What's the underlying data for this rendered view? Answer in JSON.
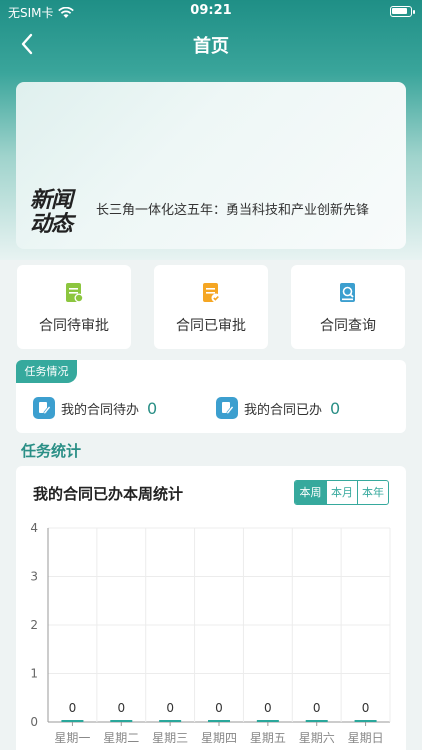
{
  "status_bar": {
    "carrier": "无SIM卡",
    "time": "09:21"
  },
  "nav": {
    "title": "首页"
  },
  "banner": {
    "logo_line1": "新闻",
    "logo_line2": "动态",
    "headline": "长三角一体化这五年：勇当科技和产业创新先锋"
  },
  "quick_actions": [
    {
      "label": "合同待审批",
      "icon": "pending-document-icon"
    },
    {
      "label": "合同已审批",
      "icon": "approved-document-icon"
    },
    {
      "label": "合同查询",
      "icon": "search-document-icon"
    }
  ],
  "tasks": {
    "tag": "任务情况",
    "items": [
      {
        "label": "我的合同待办",
        "count": "0"
      },
      {
        "label": "我的合同已办",
        "count": "0"
      }
    ]
  },
  "section": {
    "title": "任务统计"
  },
  "stats": {
    "title": "我的合同已办本周统计",
    "tabs": [
      "本周",
      "本月",
      "本年"
    ],
    "active_tab": "本周"
  },
  "colors": {
    "accent": "#36a99d",
    "header": "#1f8f86",
    "bar": "#2aa79b"
  },
  "chart_data": {
    "type": "bar",
    "categories": [
      "星期一",
      "星期二",
      "星期三",
      "星期四",
      "星期五",
      "星期六",
      "星期日"
    ],
    "values": [
      0,
      0,
      0,
      0,
      0,
      0,
      0
    ],
    "yticks": [
      "0",
      "1",
      "2",
      "3",
      "4"
    ],
    "ylim": [
      0,
      4
    ],
    "grid": true
  }
}
